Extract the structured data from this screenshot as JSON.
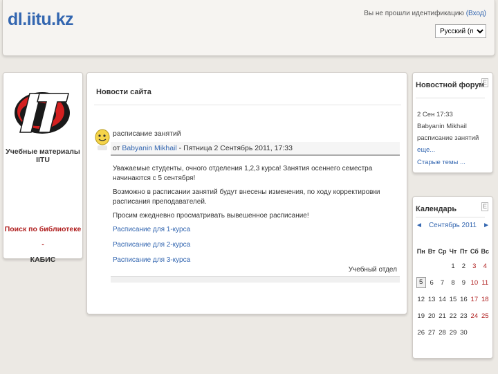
{
  "header": {
    "site_title": "dl.iitu.kz",
    "login_text": "Вы не прошли идентификацию",
    "login_link": "(Вход)",
    "language": "Русский (ru)"
  },
  "left": {
    "logo_text": "IT",
    "materials_link": "Учебные материалы IITU",
    "library_line1": "Поиск по библиотеке -",
    "library_line2": "КАБИС"
  },
  "news": {
    "title": "Новости сайта",
    "post": {
      "subject": "расписание занятий",
      "meta_prefix": "от",
      "author": "Babyanin Mikhail",
      "meta_date": "- Пятница 2 Сентябрь 2011, 17:33",
      "paragraphs": [
        "Уважаемые студенты, очного отделения 1,2,3 курса! Занятия осеннего семестра начинаются с 5 сентября!",
        "Возможно в расписании занятий будут внесены изменения, по ходу корректировки расписания преподавателей.",
        "Просим ежедневно просматривать вывешенное расписание!"
      ],
      "schedule_links": [
        "Расписание для 1-курса",
        "Расписание для 2-курса",
        "Расписание для 3-курса"
      ],
      "footer": "Учебный отдел"
    }
  },
  "forum": {
    "title": "Новостной форум",
    "collapse": "E",
    "date": "2 Сен 17:33",
    "author": "Babyanin Mikhail",
    "subject": "расписание занятий",
    "more": "еще...",
    "old_topics": "Старые темы ..."
  },
  "calendar": {
    "title": "Календарь",
    "collapse": "E",
    "prev": "◄",
    "next": "►",
    "month": "Сентябрь 2011",
    "weekdays": [
      "Пн",
      "Вт",
      "Ср",
      "Чт",
      "Пт",
      "Сб",
      "Вс"
    ],
    "weeks": [
      [
        "",
        "",
        "",
        "1",
        "2",
        "3",
        "4"
      ],
      [
        "5",
        "6",
        "7",
        "8",
        "9",
        "10",
        "11"
      ],
      [
        "12",
        "13",
        "14",
        "15",
        "16",
        "17",
        "18"
      ],
      [
        "19",
        "20",
        "21",
        "22",
        "23",
        "24",
        "25"
      ],
      [
        "26",
        "27",
        "28",
        "29",
        "30",
        "",
        ""
      ]
    ],
    "today": "5"
  },
  "colors": {
    "link": "#3366b0",
    "weekend": "#b02020",
    "logo_red": "#d42020"
  }
}
